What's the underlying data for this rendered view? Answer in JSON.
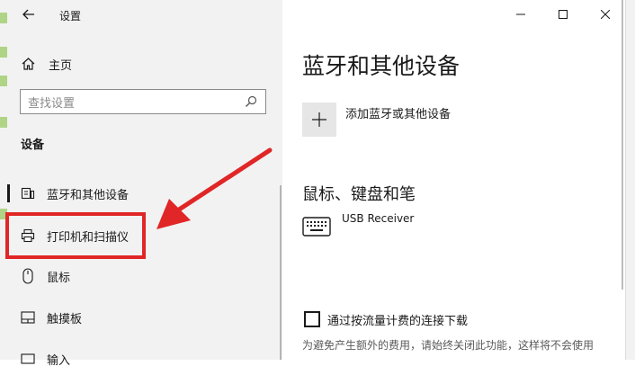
{
  "window": {
    "title": "设置",
    "controls": {
      "minimize": "minimize-icon",
      "maximize": "maximize-icon",
      "close": "close-icon"
    }
  },
  "sidebar": {
    "home_label": "主页",
    "search_placeholder": "查找设置",
    "section_title": "设备",
    "items": [
      {
        "label": "蓝牙和其他设备",
        "icon": "bluetooth-device-icon",
        "selected": true
      },
      {
        "label": "打印机和扫描仪",
        "icon": "printer-icon",
        "highlighted": true
      },
      {
        "label": "鼠标",
        "icon": "mouse-icon"
      },
      {
        "label": "触摸板",
        "icon": "touchpad-icon"
      },
      {
        "label": "输入",
        "icon": "keyboard-icon"
      }
    ]
  },
  "main": {
    "page_title": "蓝牙和其他设备",
    "add_device_label": "添加蓝牙或其他设备",
    "mouse_keyboard_title": "鼠标、键盘和笔",
    "devices": [
      {
        "name": "USB Receiver",
        "icon": "keyboard-icon"
      }
    ],
    "metered": {
      "label": "通过按流量计费的连接下载",
      "checked": false,
      "description": "为避免产生额外的费用，请始终关闭此功能，这样将不会使用"
    }
  },
  "annotation": {
    "arrow_color": "#e02626",
    "box_color": "#e02626"
  }
}
